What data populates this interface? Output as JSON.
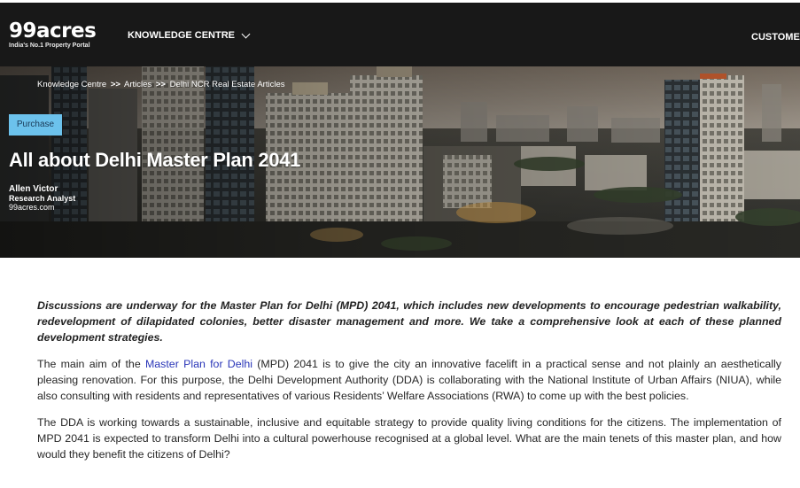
{
  "header": {
    "logo_text": "99acres",
    "logo_tagline": "India's No.1 Property Portal",
    "nav_knowledge": "KNOWLEDGE CENTRE",
    "nav_customer": "CUSTOMER"
  },
  "hero": {
    "breadcrumb": {
      "item1": "Knowledge Centre",
      "sep": ">>",
      "item2": "Articles",
      "item3": "Delhi NCR Real Estate Articles"
    },
    "badge": "Purchase",
    "title": "All about Delhi Master Plan 2041",
    "author": {
      "name": "Allen Victor",
      "role": "Research Analyst",
      "site": "99acres.com"
    }
  },
  "article": {
    "lead": "Discussions are underway for the Master Plan for Delhi (MPD) 2041, which includes new developments to encourage pedestrian walkability, redevelopment of dilapidated colonies, better disaster management and more. We take a comprehensive look at each of these planned development strategies.",
    "para1_pre": "The main aim of the ",
    "para1_link": "Master Plan for Delhi",
    "para1_post": " (MPD) 2041 is to give the city an innovative facelift in a practical sense and not plainly an aesthetically pleasing renovation. For this purpose, the Delhi Development Authority (DDA) is collaborating with the National Institute of Urban Affairs (NIUA), while also consulting with residents and representatives of various Residents’ Welfare Associations (RWA) to come up with the best policies.",
    "para2": "The DDA is working towards a sustainable, inclusive and equitable strategy to provide quality living conditions for the citizens. The implementation of MPD 2041 is expected to transform Delhi into a cultural powerhouse recognised at a global level. What are the main tenets of this master plan, and how would they benefit the citizens of Delhi?"
  },
  "colors": {
    "nav_bg": "#181818",
    "badge_bg": "#6cc2ec",
    "link": "#2a36b8"
  }
}
